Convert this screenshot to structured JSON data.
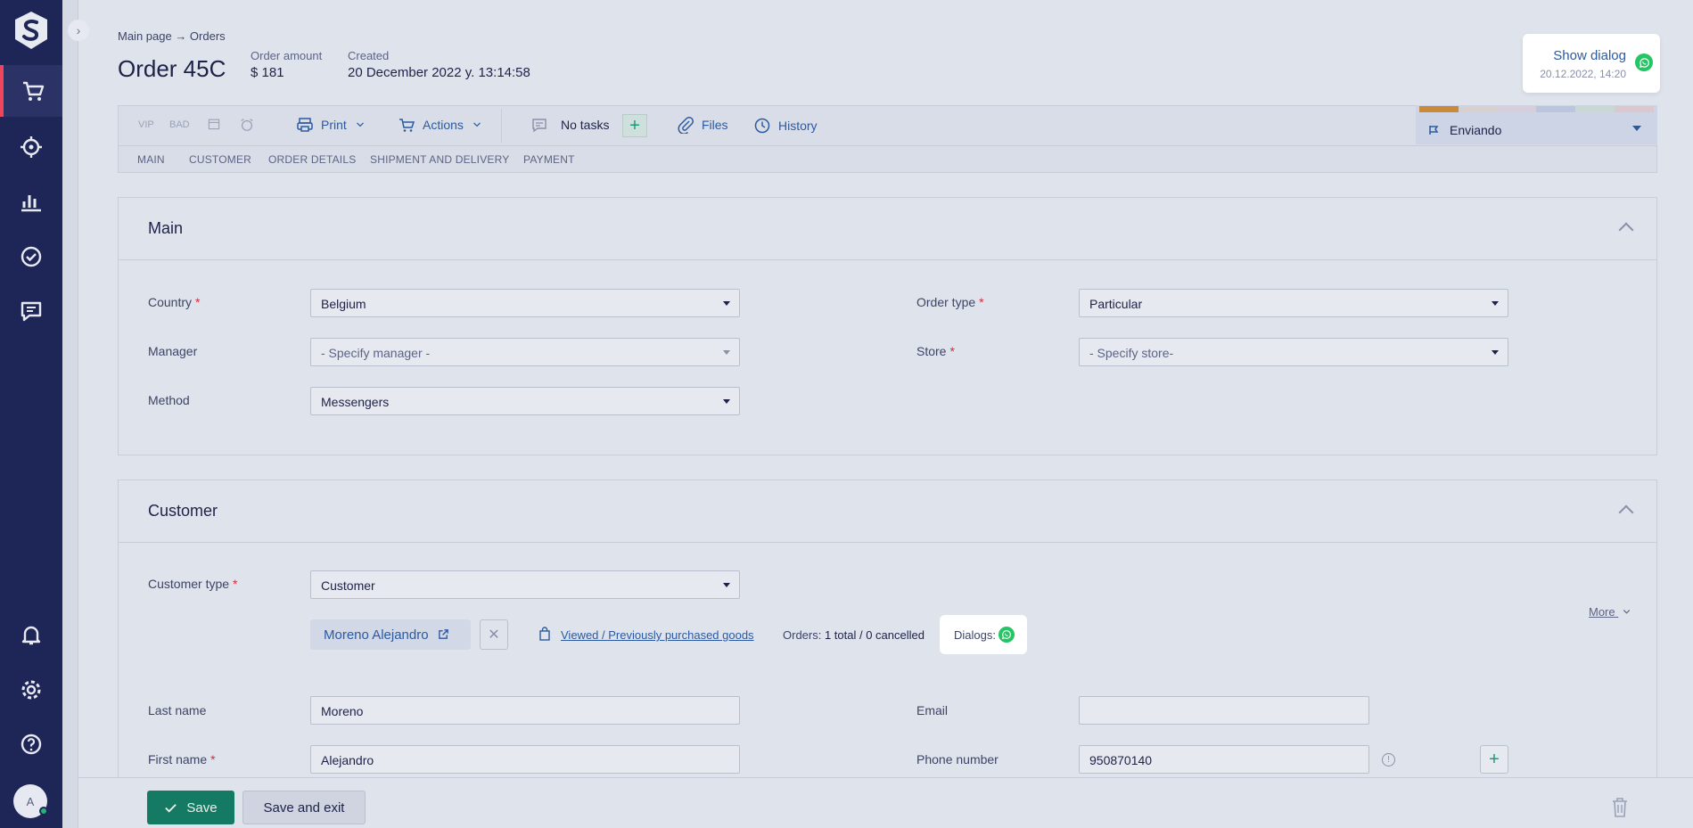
{
  "breadcrumb": "Main page → Orders",
  "order": {
    "title": "Order 45C",
    "amount_label": "Order amount",
    "amount_value": "$ 181",
    "created_label": "Created",
    "created_value": "20 December 2022 y. 13:14:58"
  },
  "dialog_popup": {
    "link": "Show dialog",
    "date": "20.12.2022, 14:20",
    "icon": "whatsapp-icon"
  },
  "toolbar": {
    "vip": "VIP",
    "bad": "BAD",
    "print": "Print",
    "actions": "Actions",
    "no_tasks": "No tasks",
    "files": "Files",
    "history": "History"
  },
  "tabs": [
    "MAIN",
    "CUSTOMER",
    "ORDER DETAILS",
    "SHIPMENT AND DELIVERY",
    "PAYMENT"
  ],
  "status": {
    "label": "Enviando",
    "bar_colors": [
      "#c98a3c",
      "#d8cfcf",
      "#d8cdda",
      "#b9c6de",
      "#c9d8d3",
      "#dcc8cc"
    ]
  },
  "main_section": {
    "title": "Main",
    "country_label": "Country",
    "country_value": "Belgium",
    "manager_label": "Manager",
    "manager_value": "- Specify manager -",
    "method_label": "Method",
    "method_value": "Messengers",
    "order_type_label": "Order type",
    "order_type_value": "Particular",
    "store_label": "Store",
    "store_value": "- Specify store-"
  },
  "customer_section": {
    "title": "Customer",
    "customer_type_label": "Customer type",
    "customer_type_value": "Customer",
    "customer_name": "Moreno Alejandro",
    "viewed_link": "Viewed / Previously purchased goods",
    "orders_label": "Orders:",
    "orders_value": "1 total / 0 cancelled",
    "dialogs_label": "Dialogs:",
    "more": "More",
    "last_name_label": "Last name",
    "last_name_value": "Moreno",
    "first_name_label": "First name",
    "first_name_value": "Alejandro",
    "email_label": "Email",
    "email_value": "",
    "phone_label": "Phone number",
    "phone_value": "950870140"
  },
  "footer": {
    "save": "Save",
    "save_exit": "Save and exit"
  },
  "user": {
    "avatar_initial": "A"
  }
}
